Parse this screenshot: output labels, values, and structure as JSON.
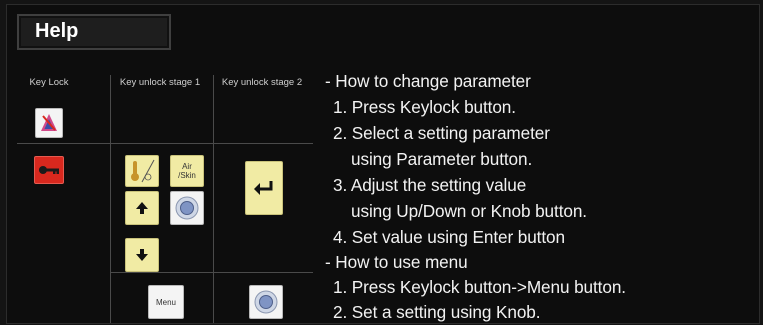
{
  "window": {
    "title": "Help"
  },
  "table": {
    "headers": [
      "Key Lock",
      "Key unlock stage 1",
      "Key unlock stage 2"
    ],
    "buttons": {
      "air_skin": "Air\n/Skin",
      "menu": "Menu"
    }
  },
  "instructions": [
    "- How to change parameter",
    "1. Press Keylock button.",
    "2. Select a setting parameter",
    "using Parameter button.",
    "3. Adjust the setting value",
    "using Up/Down or Knob button.",
    "4. Set value using Enter button",
    "- How to use menu",
    "1. Press Keylock button->Menu button.",
    "2. Set a setting using Knob."
  ],
  "colors": {
    "background": "#0d0d0d",
    "red_key": "#d8281e",
    "yellow_key": "#f1eba4",
    "text": "#f2f2f2"
  }
}
